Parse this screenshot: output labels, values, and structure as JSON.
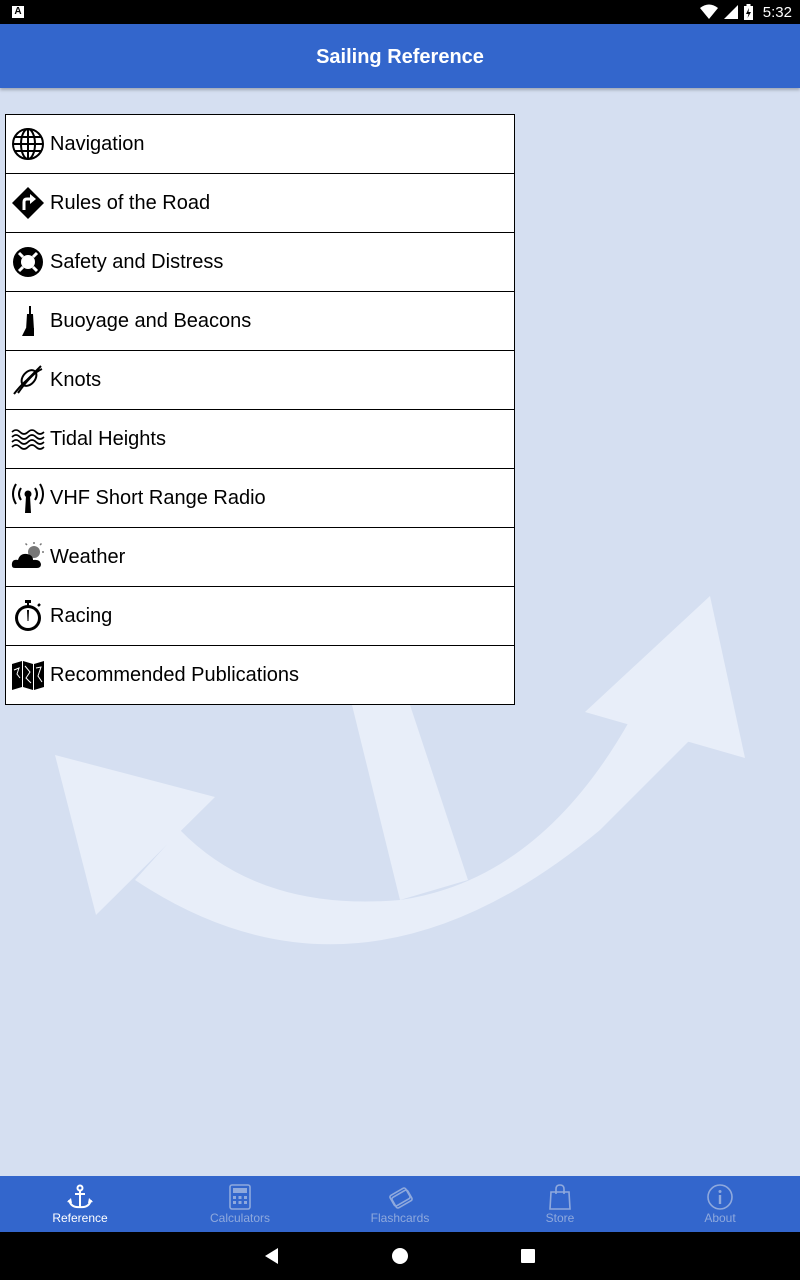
{
  "status_bar": {
    "time": "5:32",
    "left_icon": "A"
  },
  "app_bar": {
    "title": "Sailing Reference"
  },
  "menu": {
    "items": [
      {
        "label": "Navigation",
        "icon": "globe-icon"
      },
      {
        "label": "Rules of the Road",
        "icon": "road-sign-icon"
      },
      {
        "label": "Safety and Distress",
        "icon": "lifebuoy-icon"
      },
      {
        "label": "Buoyage and Beacons",
        "icon": "buoy-icon"
      },
      {
        "label": "Knots",
        "icon": "knot-icon"
      },
      {
        "label": "Tidal Heights",
        "icon": "waves-icon"
      },
      {
        "label": "VHF Short Range Radio",
        "icon": "antenna-icon"
      },
      {
        "label": "Weather",
        "icon": "cloud-sun-icon"
      },
      {
        "label": "Racing",
        "icon": "stopwatch-icon"
      },
      {
        "label": "Recommended Publications",
        "icon": "map-icon"
      }
    ]
  },
  "tabs": [
    {
      "label": "Reference",
      "icon": "anchor-icon",
      "active": true
    },
    {
      "label": "Calculators",
      "icon": "calculator-icon",
      "active": false
    },
    {
      "label": "Flashcards",
      "icon": "flashcards-icon",
      "active": false
    },
    {
      "label": "Store",
      "icon": "shopping-bag-icon",
      "active": false
    },
    {
      "label": "About",
      "icon": "info-icon",
      "active": false
    }
  ],
  "colors": {
    "primary": "#3366cc",
    "background": "#d5dff1",
    "inactive_tab": "#8fa9dd"
  }
}
